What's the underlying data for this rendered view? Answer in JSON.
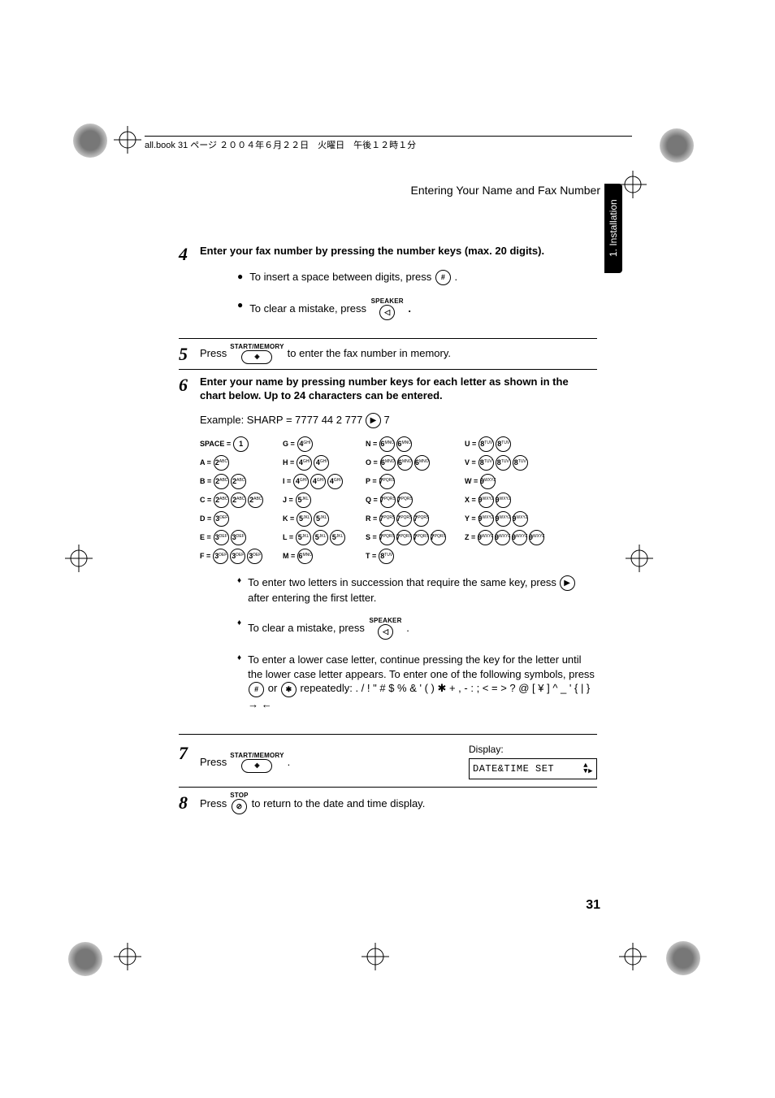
{
  "header_line": "all.book  31 ページ  ２００４年６月２２日　火曜日　午後１２時１分",
  "running_head": "Entering Your Name and Fax Number",
  "side_tab": "1. Installation",
  "page_number": "31",
  "buttons": {
    "start_memory": "START/MEMORY",
    "speaker": "SPEAKER",
    "stop": "STOP",
    "hash": "#",
    "star": "✱"
  },
  "steps": {
    "s4": {
      "num": "4",
      "title": "Enter your fax number by pressing the number keys (max. 20 digits).",
      "b1a": "To insert a space between digits, press ",
      "b1b": " .",
      "b2a": "To clear a mistake, press ",
      "b2b": " ."
    },
    "s5": {
      "num": "5",
      "pre": "Press ",
      "post": " to enter the fax number in memory."
    },
    "s6": {
      "num": "6",
      "title": "Enter your name by pressing number keys for each letter as shown in the chart below. Up to 24 characters can be entered.",
      "example_pre": "Example: SHARP = 7777  44  2  777 ",
      "example_post": "  7",
      "n1a": "To enter two letters in succession that require the same key, press ",
      "n1b": " after entering the first letter.",
      "n2a": "To clear a mistake, press ",
      "n2b": " .",
      "n3a": "To enter a lower case letter, continue pressing the key for the letter until the lower case letter appears. To enter one of the following symbols, press",
      "n3mid": " or ",
      "n3syms": " repeatedly: . / ! \" # $ % & ' ( ) ✱ + , - : ; < = > ? @ [ ¥ ] ^ _ ' { | } → ←"
    },
    "s7": {
      "num": "7",
      "pre": "Press ",
      "post": " .",
      "display_label": "Display:",
      "display_value": "DATE&TIME SET"
    },
    "s8": {
      "num": "8",
      "pre": "Press ",
      "post": " to return to the date and time display."
    }
  },
  "char_table": {
    "c1": [
      {
        "lab": "SPACE =",
        "keys": [
          "1"
        ]
      },
      {
        "lab": "A =",
        "keys": [
          "2ABC"
        ]
      },
      {
        "lab": "B =",
        "keys": [
          "2ABC",
          "2ABC"
        ]
      },
      {
        "lab": "C =",
        "keys": [
          "2ABC",
          "2ABC",
          "2ABC"
        ]
      },
      {
        "lab": "D =",
        "keys": [
          "3DEF"
        ]
      },
      {
        "lab": "E =",
        "keys": [
          "3DEF",
          "3DEF"
        ]
      },
      {
        "lab": "F =",
        "keys": [
          "3DEF",
          "3DEF",
          "3DEF"
        ]
      }
    ],
    "c2": [
      {
        "lab": "G =",
        "keys": [
          "4GHI"
        ]
      },
      {
        "lab": "H =",
        "keys": [
          "4GHI",
          "4GHI"
        ]
      },
      {
        "lab": "I =",
        "keys": [
          "4GHI",
          "4GHI",
          "4GHI"
        ]
      },
      {
        "lab": "J =",
        "keys": [
          "5JKL"
        ]
      },
      {
        "lab": "K =",
        "keys": [
          "5JKL",
          "5JKL"
        ]
      },
      {
        "lab": "L =",
        "keys": [
          "5JKL",
          "5JKL",
          "5JKL"
        ]
      },
      {
        "lab": "M =",
        "keys": [
          "6MNO"
        ]
      }
    ],
    "c3": [
      {
        "lab": "N =",
        "keys": [
          "6MNO",
          "6MNO"
        ]
      },
      {
        "lab": "O =",
        "keys": [
          "6MNO",
          "6MNO",
          "6MNO"
        ]
      },
      {
        "lab": "P =",
        "keys": [
          "7PQRS"
        ]
      },
      {
        "lab": "Q =",
        "keys": [
          "7PQRS",
          "7PQRS"
        ]
      },
      {
        "lab": "R =",
        "keys": [
          "7PQRS",
          "7PQRS",
          "7PQRS"
        ]
      },
      {
        "lab": "S =",
        "keys": [
          "7PQRS",
          "7PQRS",
          "7PQRS",
          "7PQRS"
        ]
      },
      {
        "lab": "T =",
        "keys": [
          "8TUV"
        ]
      }
    ],
    "c4": [
      {
        "lab": "U =",
        "keys": [
          "8TUV",
          "8TUV"
        ]
      },
      {
        "lab": "V =",
        "keys": [
          "8TUV",
          "8TUV",
          "8TUV"
        ]
      },
      {
        "lab": "W =",
        "keys": [
          "9WXYZ"
        ]
      },
      {
        "lab": "X =",
        "keys": [
          "9WXYZ",
          "9WXYZ"
        ]
      },
      {
        "lab": "Y =",
        "keys": [
          "9WXYZ",
          "9WXYZ",
          "9WXYZ"
        ]
      },
      {
        "lab": "Z =",
        "keys": [
          "9WXYZ",
          "9WXYZ",
          "9WXYZ",
          "9WXYZ"
        ]
      }
    ]
  }
}
